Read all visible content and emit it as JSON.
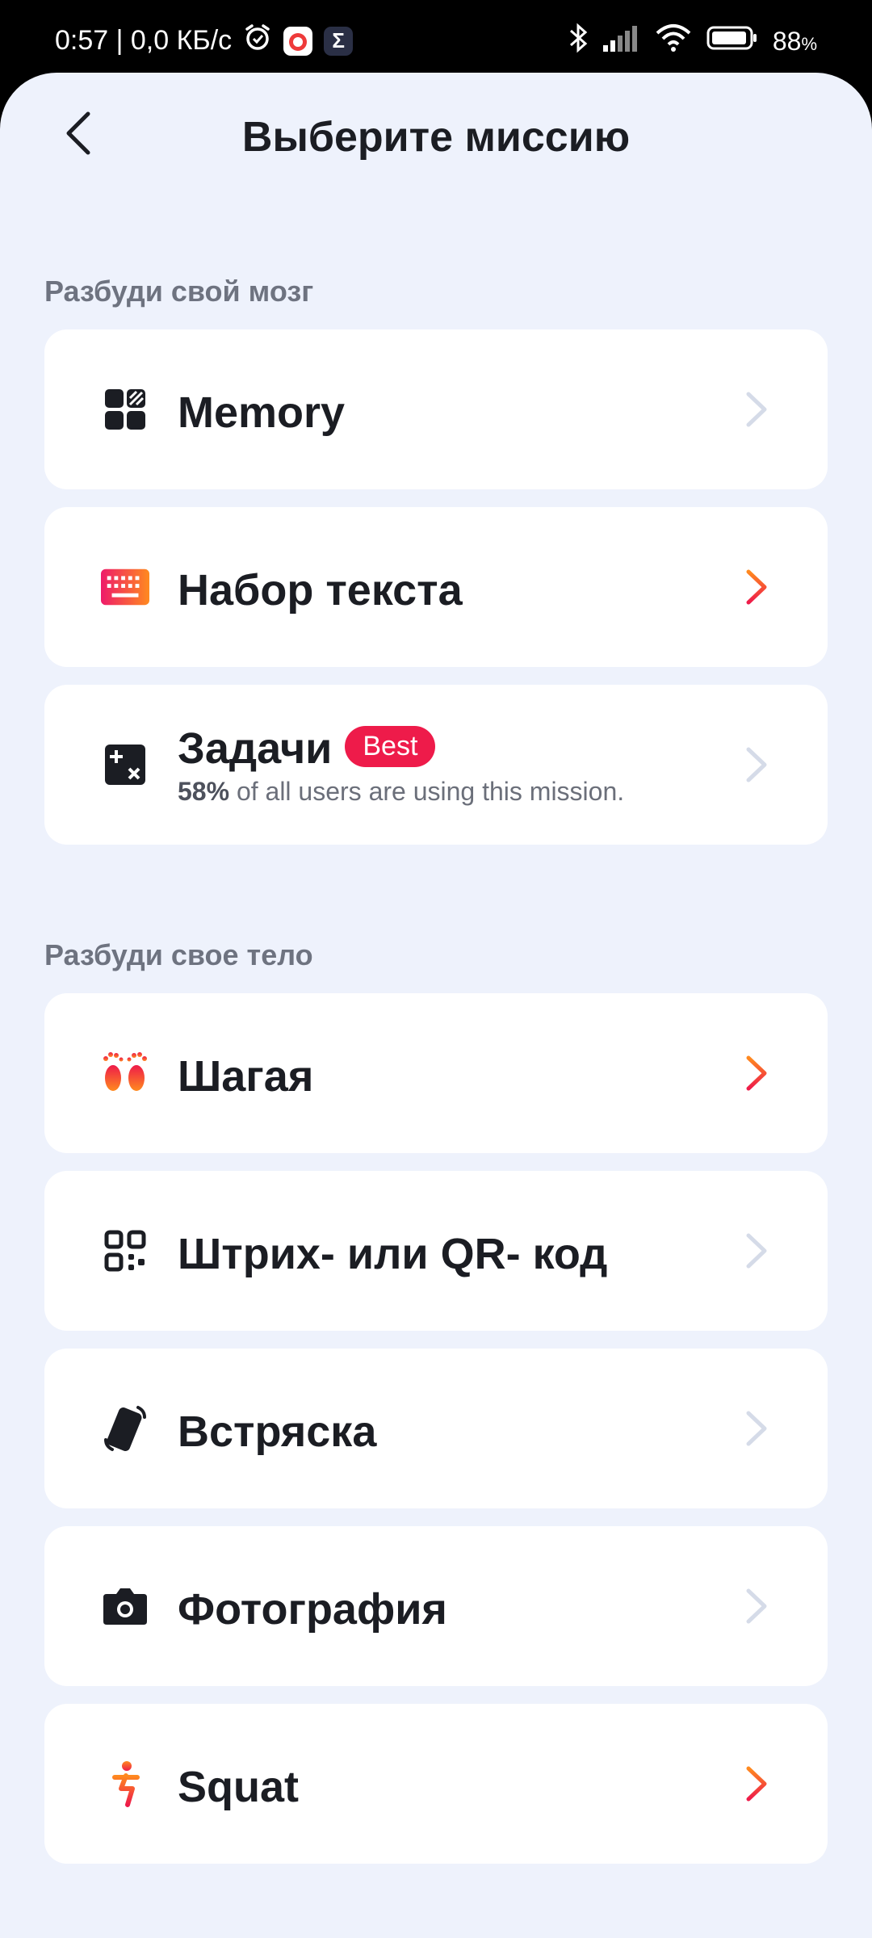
{
  "status_bar": {
    "time_speed": "0:57 | 0,0 КБ/с",
    "battery_percent": "88",
    "battery_unit": "%"
  },
  "header": {
    "title": "Выберите миссию"
  },
  "sections": [
    {
      "label": "Разбуди свой мозг",
      "items": [
        {
          "label": "Memory",
          "icon": "memory-grid-icon",
          "chevron_color": "#d5dbe8"
        },
        {
          "label": "Набор текста",
          "icon": "keyboard-icon",
          "chevron_color": "#ef4a3a"
        },
        {
          "label": "Задачи",
          "icon": "math-icon",
          "badge": "Best",
          "sub_pct": "58%",
          "sub_text": " of all users are using this mission.",
          "chevron_color": "#d5dbe8"
        }
      ]
    },
    {
      "label": "Разбуди свое тело",
      "items": [
        {
          "label": "Шагая",
          "icon": "footsteps-icon",
          "chevron_color": "#ef4a3a"
        },
        {
          "label": "Штрих- или QR- код",
          "icon": "qr-code-icon",
          "chevron_color": "#d5dbe8"
        },
        {
          "label": "Встряска",
          "icon": "phone-shake-icon",
          "chevron_color": "#d5dbe8"
        },
        {
          "label": "Фотография",
          "icon": "camera-icon",
          "chevron_color": "#d5dbe8"
        },
        {
          "label": "Squat",
          "icon": "squat-icon",
          "chevron_color": "#ef4a3a"
        }
      ]
    }
  ],
  "colors": {
    "accent": "#ee1b4a",
    "background": "#eef2fc",
    "card": "#ffffff"
  }
}
